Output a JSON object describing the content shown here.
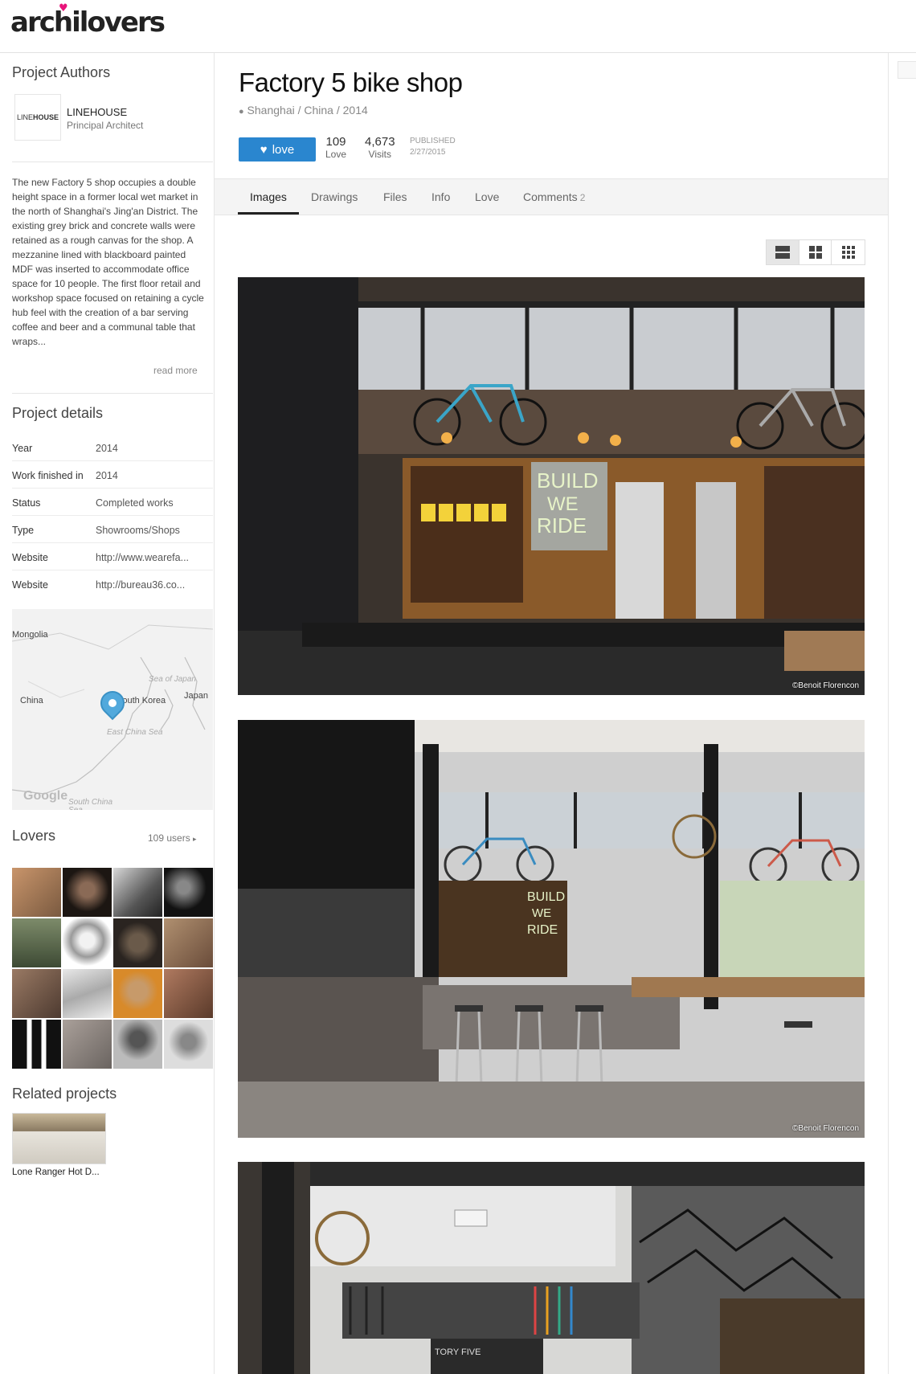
{
  "brand": {
    "name": "archilovers"
  },
  "sidebar": {
    "authors_title": "Project Authors",
    "author": {
      "logo_text_light": "LINE",
      "logo_text_bold": "HOUSE",
      "name": "LINEHOUSE",
      "role": "Principal Architect"
    },
    "description": "The new Factory 5 shop occupies a double height space in a former local wet market in the north of Shanghai's Jing'an District. The existing grey brick and concrete walls were retained as a rough canvas for the shop. A mezzanine lined with blackboard painted MDF was inserted to accommodate office space for 10 people. The first floor retail and workshop space focused on retaining a cycle hub feel with the creation of a bar serving coffee and beer and a communal table that wraps...",
    "read_more": "read more",
    "details_title": "Project details",
    "details": [
      {
        "key": "Year",
        "value": "2014"
      },
      {
        "key": "Work finished in",
        "value": "2014"
      },
      {
        "key": "Status",
        "value": "Completed works"
      },
      {
        "key": "Type",
        "value": "Showrooms/Shops"
      },
      {
        "key": "Website",
        "value": "http://www.wearefa..."
      },
      {
        "key": "Website",
        "value": "http://bureau36.co..."
      }
    ],
    "map": {
      "labels": [
        "Mongolia",
        "China",
        "South Korea",
        "Japan"
      ],
      "seas": [
        "Sea of Japan",
        "East China Sea",
        "South China Sea"
      ],
      "google": "Google"
    },
    "lovers_title": "Lovers",
    "lovers_count": "109 users",
    "related_title": "Related projects",
    "related_item": "Lone Ranger Hot D..."
  },
  "main": {
    "title": "Factory 5 bike shop",
    "location": "Shanghai / China / 2014",
    "love_button": "love",
    "stats": [
      {
        "value": "109",
        "label": "Love"
      },
      {
        "value": "4,673",
        "label": "Visits"
      }
    ],
    "published_label": "PUBLISHED",
    "published_date": "2/27/2015",
    "tabs": [
      {
        "label": "Images"
      },
      {
        "label": "Drawings"
      },
      {
        "label": "Files"
      },
      {
        "label": "Info"
      },
      {
        "label": "Love"
      },
      {
        "label": "Comments",
        "count": "2"
      }
    ],
    "photo_credit": "©Benoit Florencon",
    "photos": [
      {
        "sign_line1": "BUILD",
        "sign_line2": "WE",
        "sign_line3": "RIDE"
      },
      {
        "sign_line1": "BUILD",
        "sign_line2": "WE",
        "sign_line3": "RIDE"
      },
      {
        "sign_line1": "TORY FIVE"
      }
    ]
  },
  "colors": {
    "accent": "#2a86cf",
    "heart": "#e8147a"
  }
}
